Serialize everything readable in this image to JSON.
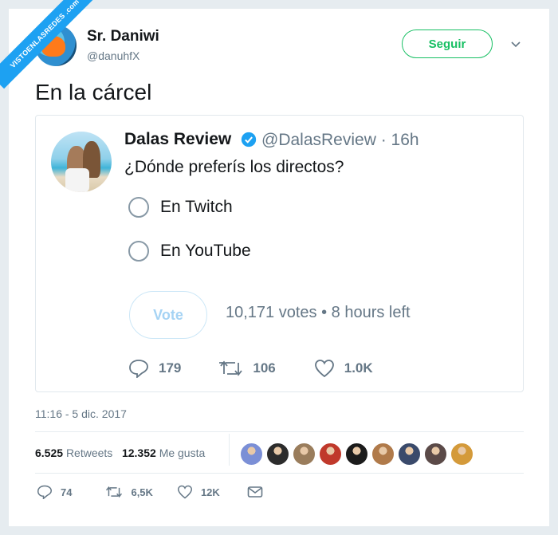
{
  "watermark": "VISTOENLASREDES .com",
  "author": {
    "name": "Sr. Daniwi",
    "handle": "@danuhfX"
  },
  "follow_label": "Seguir",
  "tweet_text": "En la cárcel",
  "quoted": {
    "name": "Dalas Review",
    "meta": "@DalasReview · 16h",
    "text": "¿Dónde preferís los directos?",
    "poll": {
      "options": [
        "En Twitch",
        "En YouTube"
      ],
      "vote_label": "Vote",
      "info": "10,171 votes • 8 hours left"
    },
    "actions": {
      "replies": "179",
      "retweets": "106",
      "likes": "1.0K"
    }
  },
  "timestamp": "11:16 - 5 dic. 2017",
  "stats": {
    "retweets_count": "6.525",
    "retweets_label": "Retweets",
    "likes_count": "12.352",
    "likes_label": "Me gusta"
  },
  "liker_colors": [
    "#7b8fd6",
    "#2c2c2c",
    "#9a7d5c",
    "#c0392b",
    "#1b1b1b",
    "#b07a4a",
    "#3a4a6b",
    "#5b4a48",
    "#d49a3a"
  ],
  "bottom_actions": {
    "replies": "74",
    "retweets": "6,5K",
    "likes": "12K"
  },
  "colors": {
    "accent": "#1da1f2",
    "follow": "#17bf63",
    "muted": "#657786"
  }
}
